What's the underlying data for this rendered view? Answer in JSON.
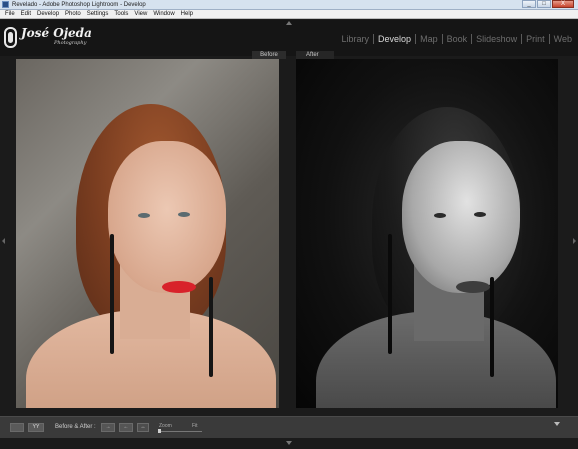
{
  "window": {
    "title": "Revelado - Adobe Photoshop Lightroom - Develop",
    "buttons": [
      "_",
      "□",
      "X"
    ]
  },
  "menubar": {
    "items": [
      "File",
      "Edit",
      "Develop",
      "Photo",
      "Settings",
      "Tools",
      "View",
      "Window",
      "Help"
    ]
  },
  "identity": {
    "name": "José Ojeda",
    "subtitle": "Photography"
  },
  "modules": {
    "items": [
      "Library",
      "Develop",
      "Map",
      "Book",
      "Slideshow",
      "Print",
      "Web"
    ],
    "active": "Develop"
  },
  "compare": {
    "before_label": "Before",
    "after_label": "After"
  },
  "toolbar": {
    "view_label": "YY",
    "before_after_label": "Before & After :",
    "zoom_label": "Zoom",
    "fit_label": "Fit"
  },
  "colors": {
    "accent_lips": "#d8222a",
    "hair_before": "#8a4a28",
    "background": "#1b1b1b"
  }
}
